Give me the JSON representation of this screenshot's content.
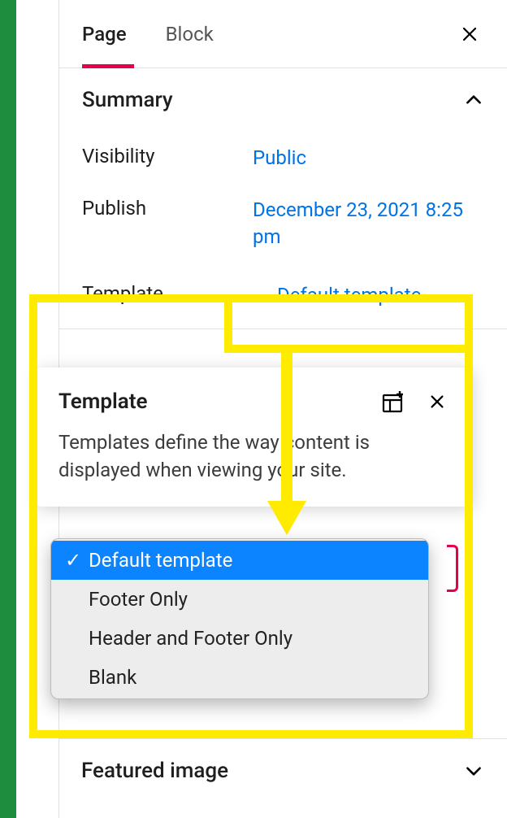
{
  "tabs": {
    "page": "Page",
    "block": "Block",
    "active": "page"
  },
  "summary": {
    "title": "Summary",
    "visibility_label": "Visibility",
    "visibility_value": "Public",
    "publish_label": "Publish",
    "publish_value": "December 23, 2021 8:25 pm",
    "template_label": "Template",
    "template_value": "Default template"
  },
  "popover": {
    "title": "Template",
    "description": "Templates define the way content is displayed when viewing your site."
  },
  "template_options": {
    "selected_index": 0,
    "items": [
      "Default template",
      "Footer Only",
      "Header and Footer Only",
      "Blank"
    ]
  },
  "featured": {
    "title": "Featured image"
  },
  "annotation": {
    "highlight_color": "#ffeb00"
  }
}
